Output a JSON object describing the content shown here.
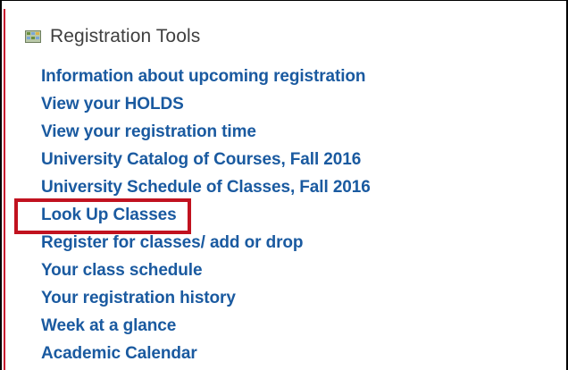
{
  "header": {
    "title": "Registration Tools",
    "icon": "tools-icon"
  },
  "links": [
    {
      "id": "info-upcoming",
      "label": "Information about upcoming registration"
    },
    {
      "id": "view-holds",
      "label": "View your HOLDS"
    },
    {
      "id": "view-reg-time",
      "label": "View your registration time"
    },
    {
      "id": "catalog-courses",
      "label": "University Catalog of Courses, Fall 2016"
    },
    {
      "id": "schedule-classes",
      "label": "University Schedule of Classes, Fall 2016"
    },
    {
      "id": "look-up-classes",
      "label": "Look Up Classes"
    },
    {
      "id": "register-classes",
      "label": "Register for classes/ add or drop"
    },
    {
      "id": "class-schedule",
      "label": "Your class schedule"
    },
    {
      "id": "registration-history",
      "label": "Your registration history"
    },
    {
      "id": "week-at-a-glance",
      "label": "Week at a glance"
    },
    {
      "id": "academic-calendar",
      "label": "Academic Calendar"
    }
  ],
  "colors": {
    "link": "#1a5aa0",
    "title": "#3f3f3f",
    "highlight": "#c1121f",
    "accent": "#c8102e"
  }
}
